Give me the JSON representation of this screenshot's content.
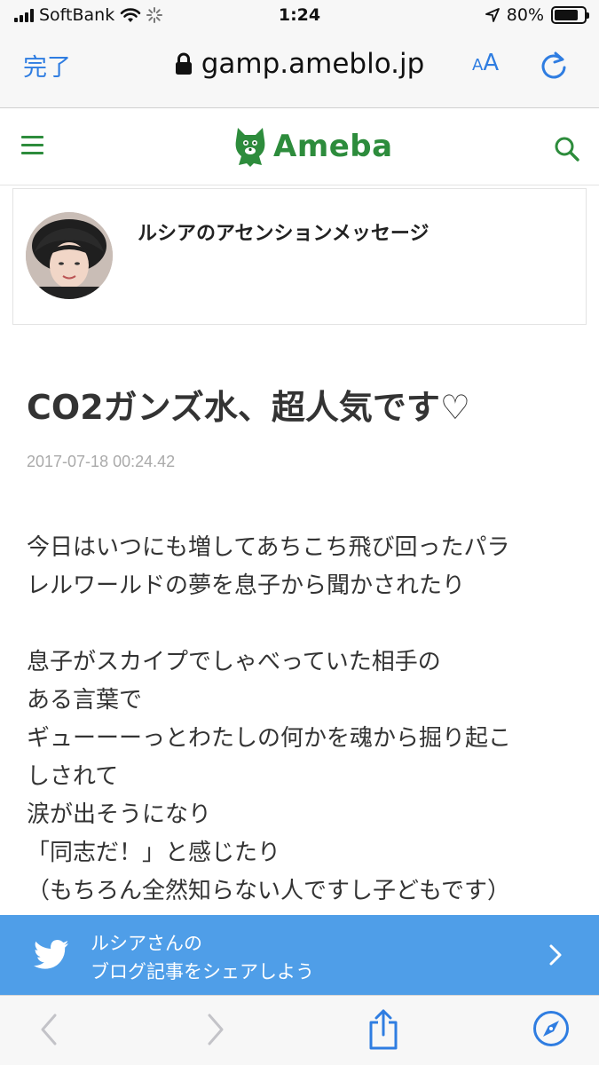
{
  "status_bar": {
    "carrier": "SoftBank",
    "time": "1:24",
    "battery_percent": "80%",
    "battery_level": 0.8
  },
  "browser": {
    "done_label": "完了",
    "url": "gamp.ameblo.jp",
    "text_size_label_small": "A",
    "text_size_label_large": "A"
  },
  "ameba_header": {
    "logo_text": "Ameba"
  },
  "blog": {
    "title": "ルシアのアセンションメッセージ"
  },
  "article": {
    "title": "CO2ガンズ水、超人気です♡",
    "date": "2017-07-18 00:24.42",
    "paragraph1": [
      "今日はいつにも増してあちこち飛び回ったパラ",
      "レルワールドの夢を息子から聞かされたり"
    ],
    "paragraph2": [
      "息子がスカイプでしゃべっていた相手の",
      "ある言葉で",
      "ギューーーっとわたしの何かを魂から掘り起こ",
      "しされて",
      "涙が出そうになり",
      "「同志だ！」と感じたり",
      "（もちろん全然知らない人ですし子どもです）"
    ]
  },
  "share_banner": {
    "line1": "ルシアさんの",
    "line2": "ブログ記事をシェアしよう"
  },
  "colors": {
    "ameba_green": "#2d8c3c",
    "ios_blue": "#2f7de1",
    "twitter_blue": "#4f9ee8"
  }
}
